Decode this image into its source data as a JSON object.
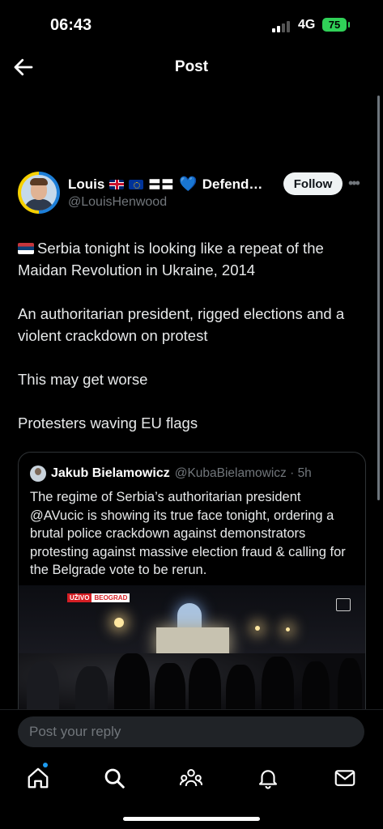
{
  "status": {
    "time": "06:43",
    "network": "4G",
    "battery": "75"
  },
  "header": {
    "title": "Post"
  },
  "post": {
    "author_name": "Louis",
    "author_suffix": "Defend…",
    "handle": "@LouisHenwood",
    "follow_label": "Follow",
    "paragraphs": [
      "Serbia tonight is looking like a repeat of the Maidan Revolution in Ukraine, 2014",
      "An authoritarian president, rigged elections and a violent crackdown on protest",
      "This may get worse",
      "Protesters waving EU flags"
    ]
  },
  "quote": {
    "author_name": "Jakub Bielamowicz",
    "handle_time": "@KubaBielamowicz · 5h",
    "text": "The regime of Serbia’s authoritarian president @AVucic is showing its true face tonight, ordering a brutal police crackdown against demonstrators protesting against massive election fraud & calling for the Belgrade vote to be rerun.",
    "media_badge_live": "UŽIVO",
    "media_badge_city": "BEOGRAD"
  },
  "reply": {
    "placeholder": "Post your reply"
  },
  "tabs": [
    "home-icon",
    "search-icon",
    "communities-icon",
    "notifications-icon",
    "messages-icon"
  ]
}
